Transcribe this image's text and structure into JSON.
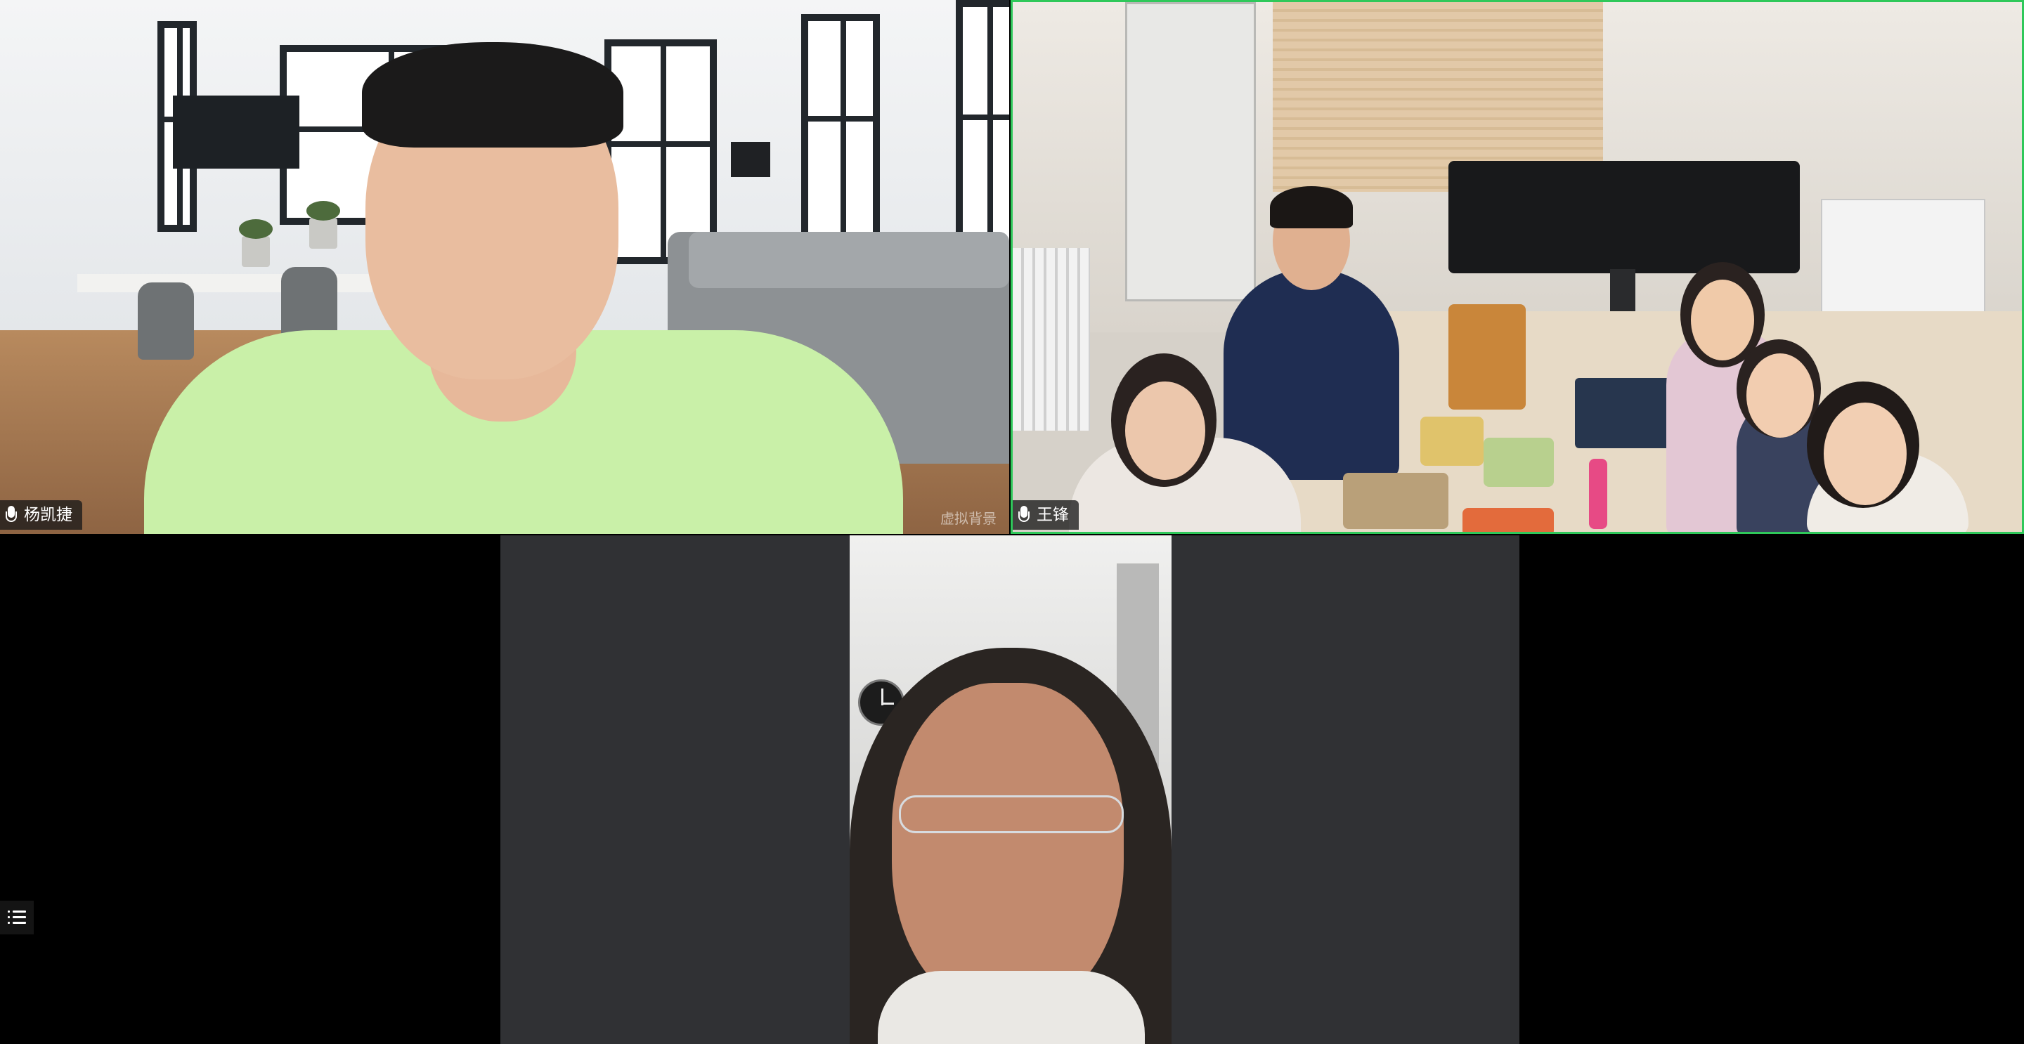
{
  "participants": [
    {
      "name": "杨凯捷",
      "watermark": "虚拟背景"
    },
    {
      "name": "王锋"
    },
    {
      "name": ""
    }
  ],
  "accent_color": "#2fc85a",
  "icons": {
    "mic": "mic-icon",
    "list": "list-icon"
  }
}
